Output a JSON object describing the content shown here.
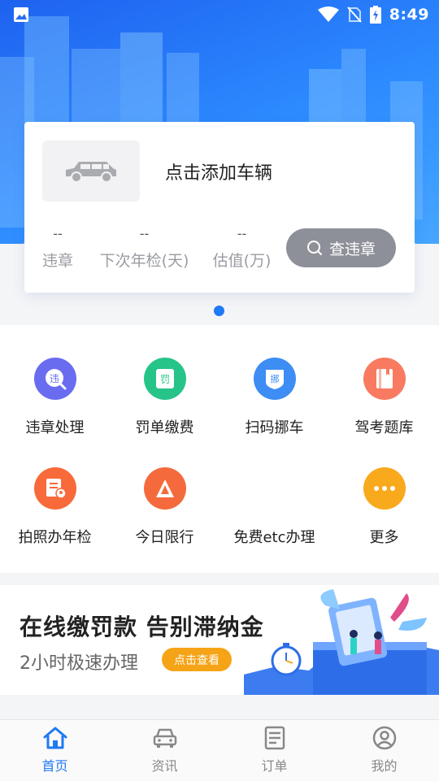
{
  "status_bar": {
    "time": "8:49"
  },
  "car_card": {
    "add_vehicle": "点击添加车辆",
    "stats": [
      {
        "value": "--",
        "label": "违章"
      },
      {
        "value": "--",
        "label": "下次年检(天)"
      },
      {
        "value": "--",
        "label": "估值(万)"
      }
    ],
    "query_button": "查违章"
  },
  "services": [
    {
      "label": "违章处理",
      "icon": "violation-icon",
      "color": "#6a6cf0",
      "glyph": "违"
    },
    {
      "label": "罚单缴费",
      "icon": "ticket-icon",
      "color": "#27c48a",
      "glyph": "罚"
    },
    {
      "label": "扫码挪车",
      "icon": "move-car-icon",
      "color": "#3d8df5",
      "glyph": "挪"
    },
    {
      "label": "驾考题库",
      "icon": "question-bank-icon",
      "color": "#f87a60",
      "glyph": ""
    },
    {
      "label": "拍照办年检",
      "icon": "inspection-icon",
      "color": "#f86a3a",
      "glyph": ""
    },
    {
      "label": "今日限行",
      "icon": "restriction-icon",
      "color": "#f46a3c",
      "glyph": ""
    },
    {
      "label": "免费etc办理",
      "icon": "",
      "color": "",
      "glyph": ""
    },
    {
      "label": "更多",
      "icon": "more-icon",
      "color": "#f9a91c",
      "glyph": ""
    }
  ],
  "banner": {
    "title": "在线缴罚款 告别滞纳金",
    "subtitle": "2小时极速办理",
    "button": "点击查看"
  },
  "tabs": [
    {
      "label": "首页",
      "icon": "home-icon",
      "active": true
    },
    {
      "label": "资讯",
      "icon": "car-icon",
      "active": false
    },
    {
      "label": "订单",
      "icon": "order-icon",
      "active": false
    },
    {
      "label": "我的",
      "icon": "profile-icon",
      "active": false
    }
  ]
}
